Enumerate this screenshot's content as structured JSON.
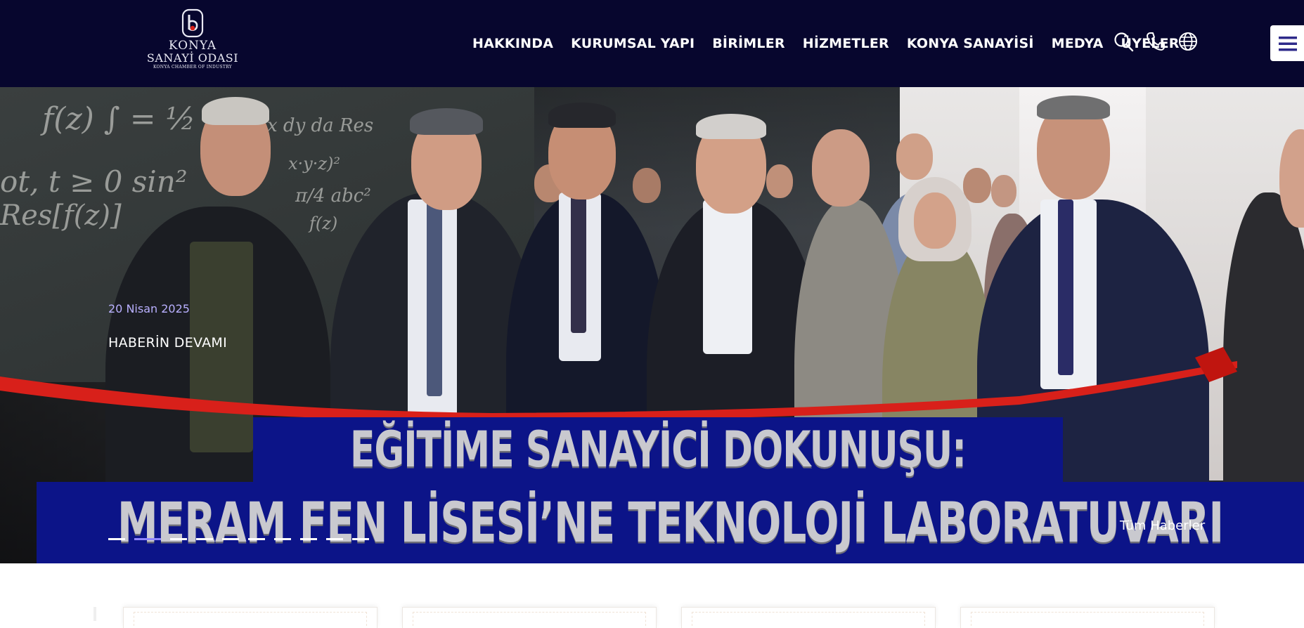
{
  "brand": {
    "line1": "KONYA",
    "line2": "SANAYİ ODASI",
    "line3": "KONYA CHAMBER OF INDUSTRY"
  },
  "nav": {
    "items": [
      {
        "label": "HAKKINDA"
      },
      {
        "label": "KURUMSAL YAPI"
      },
      {
        "label": "BİRİMLER"
      },
      {
        "label": "HİZMETLER"
      },
      {
        "label": "KONYA SANAYİSİ"
      },
      {
        "label": "MEDYA"
      },
      {
        "label": "ÜYELER"
      }
    ],
    "icons": [
      "search-icon",
      "phone-icon",
      "globe-icon",
      "hamburger-menu-icon"
    ]
  },
  "hero": {
    "date": "20 Nisan 2025",
    "cta": "HABERİN DEVAMI",
    "headline_line1": "EĞİTİME SANAYİCİ DOKUNUŞU:",
    "headline_line2": "MERAM FEN LİSESİ’NE TEKNOLOJİ LABORATUVARI",
    "all_news": "Tüm Haberler",
    "slides_total": 10,
    "active_slide": 2
  },
  "colors": {
    "header_bg": "#07062e",
    "accent": "#8f86ff",
    "date_color": "#b9b0ff",
    "banner_blue": "#0c1488",
    "ribbon_red": "#d8201a"
  }
}
